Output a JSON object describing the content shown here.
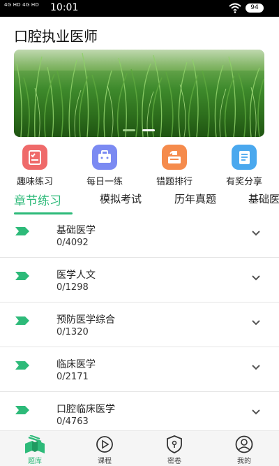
{
  "status": {
    "signal": "4G HD 4G HD",
    "time": "10:01",
    "battery": "94"
  },
  "page_title": "口腔执业医师",
  "banner": {
    "slides": 2,
    "active_slide": 2
  },
  "quick_actions": [
    {
      "label": "趣味练习",
      "icon": "quiz-sheet-icon",
      "color": "#ef6a6a"
    },
    {
      "label": "每日一练",
      "icon": "briefcase-icon",
      "color": "#7b8af2"
    },
    {
      "label": "错题排行",
      "icon": "ranking-box-icon",
      "color": "#f58b4c"
    },
    {
      "label": "有奖分享",
      "icon": "notebook-icon",
      "color": "#4aa8ee"
    }
  ],
  "tabs": [
    {
      "label": "章节练习",
      "active": true
    },
    {
      "label": "模拟考试"
    },
    {
      "label": "历年真题"
    },
    {
      "label": "基础医"
    }
  ],
  "chapters": [
    {
      "name": "基础医学",
      "progress": "0/4092"
    },
    {
      "name": "医学人文",
      "progress": "0/1298"
    },
    {
      "name": "预防医学综合",
      "progress": "0/1320"
    },
    {
      "name": "临床医学",
      "progress": "0/2171"
    },
    {
      "name": "口腔临床医学",
      "progress": "0/4763"
    }
  ],
  "bottom_nav": [
    {
      "label": "题库",
      "icon": "book-stack-icon",
      "active": true
    },
    {
      "label": "课程",
      "icon": "play-circle-icon"
    },
    {
      "label": "密卷",
      "icon": "shield-lock-icon"
    },
    {
      "label": "我的",
      "icon": "user-circle-icon"
    }
  ],
  "colors": {
    "accent": "#2dba79",
    "divider": "#e6e6e6"
  }
}
